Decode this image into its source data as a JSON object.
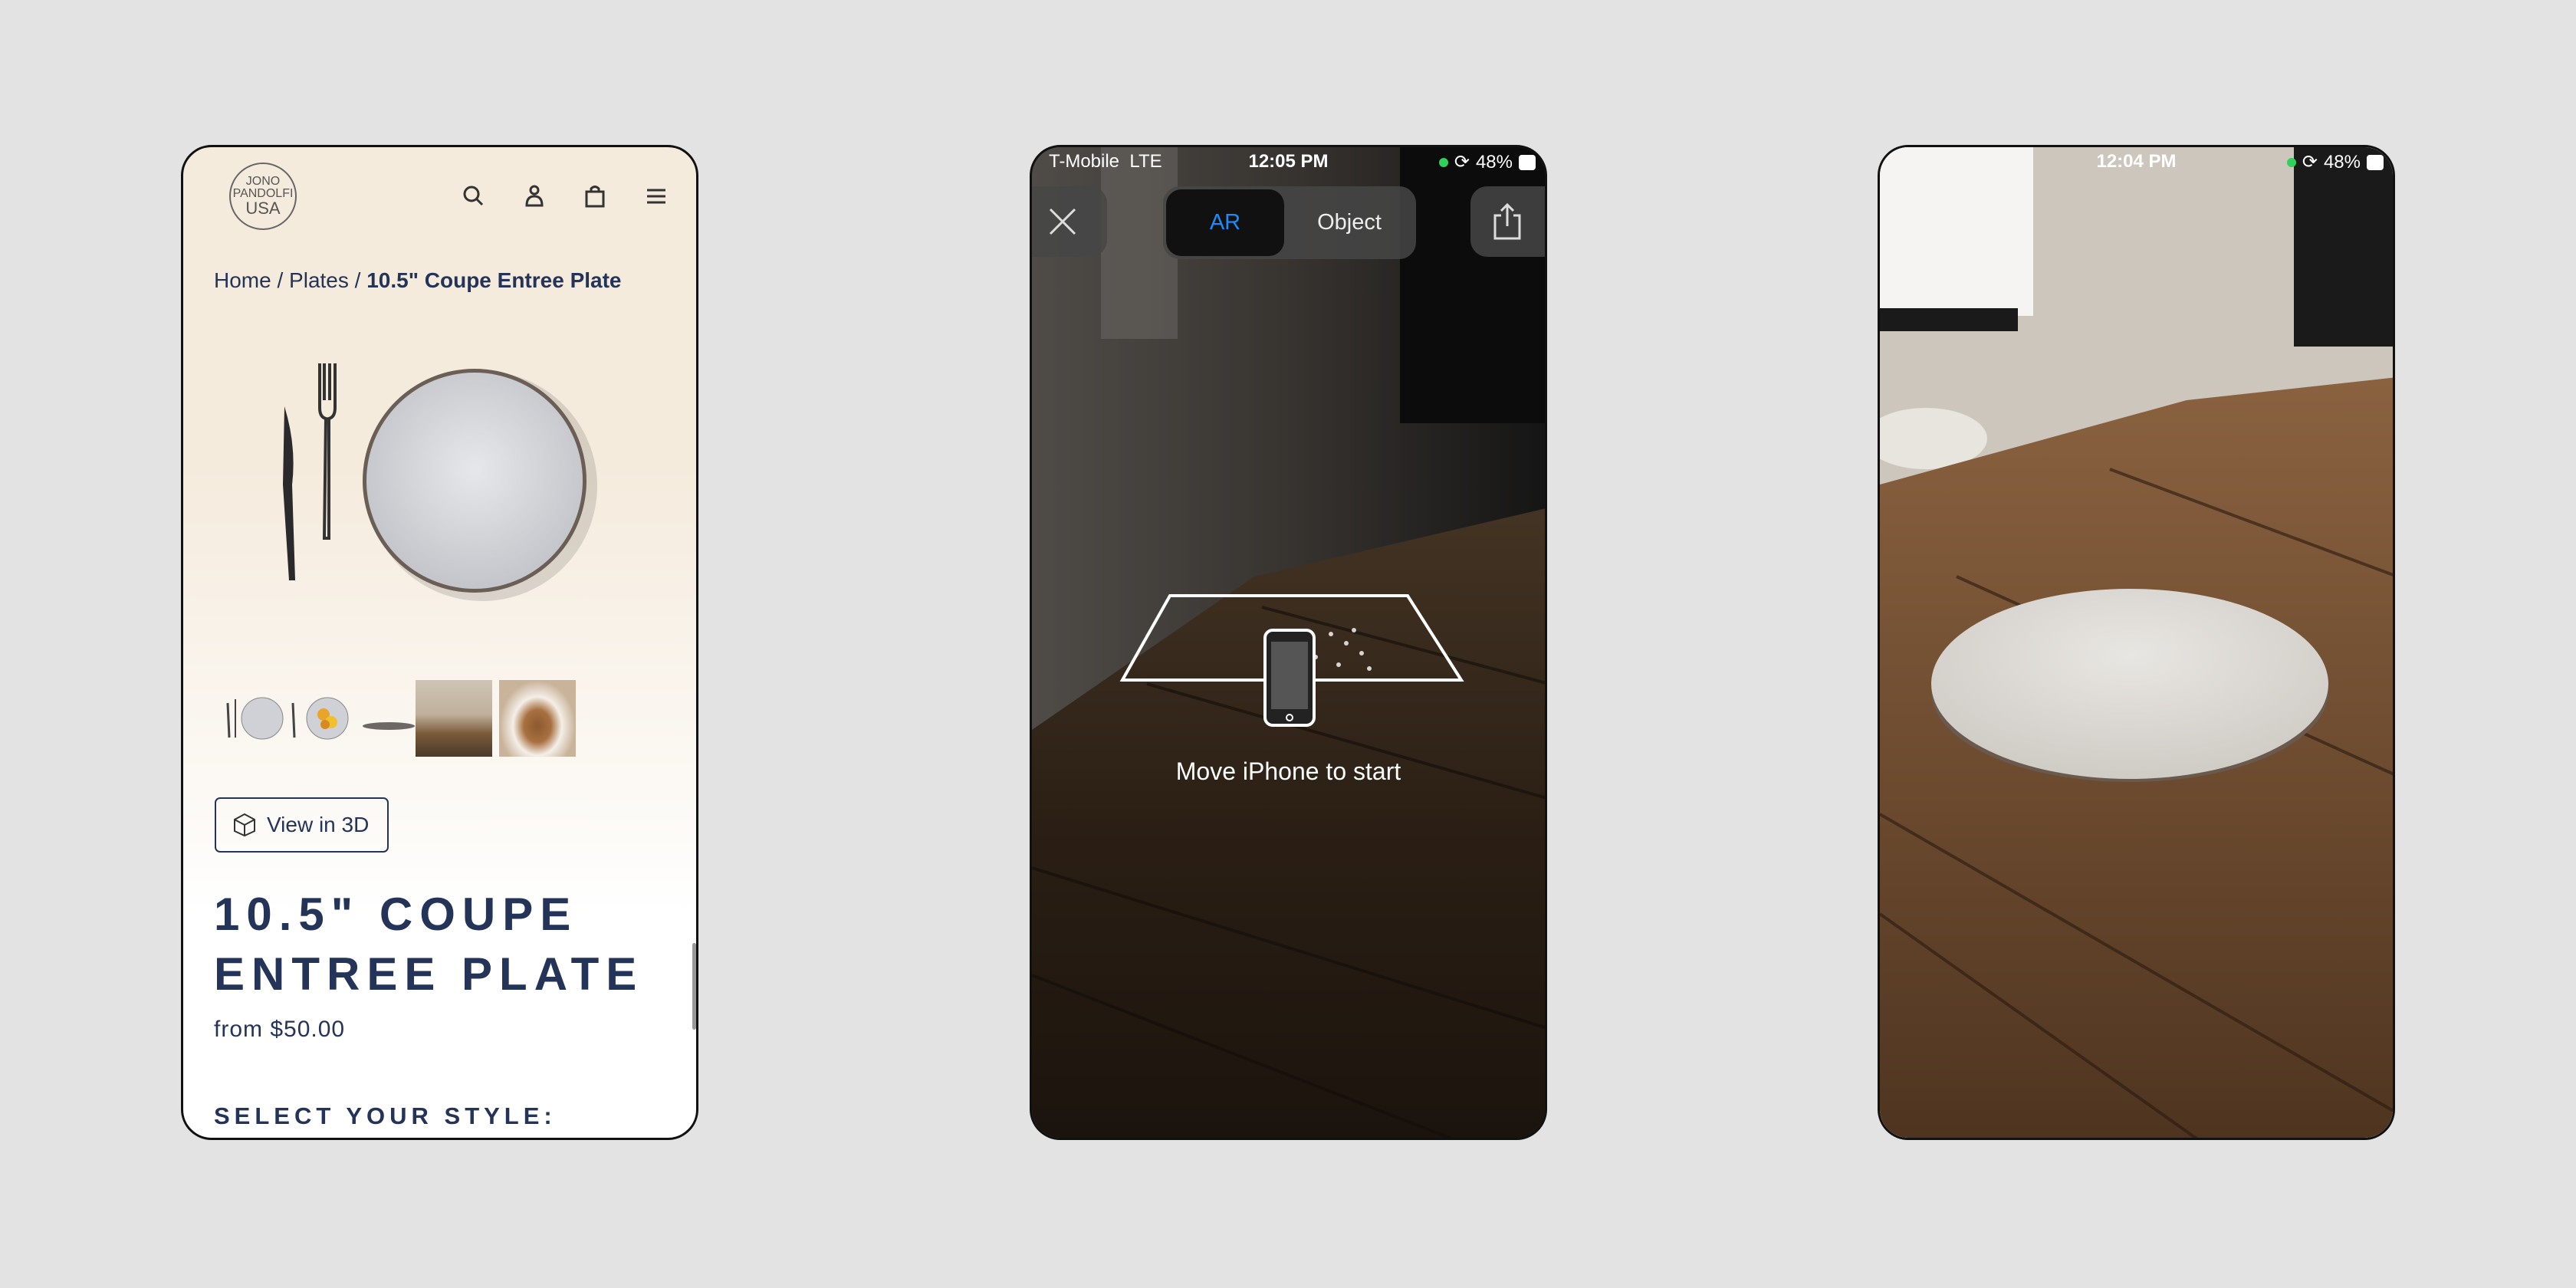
{
  "product_page": {
    "logo": {
      "line1": "JONO",
      "line2": "PANDOLFI",
      "line3": "USA"
    },
    "header_icons": [
      "search-icon",
      "account-icon",
      "cart-icon",
      "menu-icon"
    ],
    "breadcrumb": {
      "home": "Home",
      "sep": "/",
      "category": "Plates",
      "current": "10.5\" Coupe Entree Plate"
    },
    "view_3d_label": "View in 3D",
    "title_line1": "10.5\" COUPE",
    "title_line2": "ENTREE PLATE",
    "price": "from $50.00",
    "select_style": "SELECT YOUR STYLE:",
    "colors": {
      "text": "#243358",
      "background_top": "#f5ebdd"
    }
  },
  "ar_screen": {
    "status": {
      "carrier": "T-Mobile",
      "network": "LTE",
      "time": "12:05 PM",
      "battery": "48%"
    },
    "tabs": [
      {
        "label": "AR",
        "active": true
      },
      {
        "label": "Object",
        "active": false
      }
    ],
    "accent": "#1a8cff",
    "hint": "Move iPhone to start"
  },
  "ar_placed_screen": {
    "status": {
      "time": "12:04 PM",
      "battery": "48%"
    }
  }
}
